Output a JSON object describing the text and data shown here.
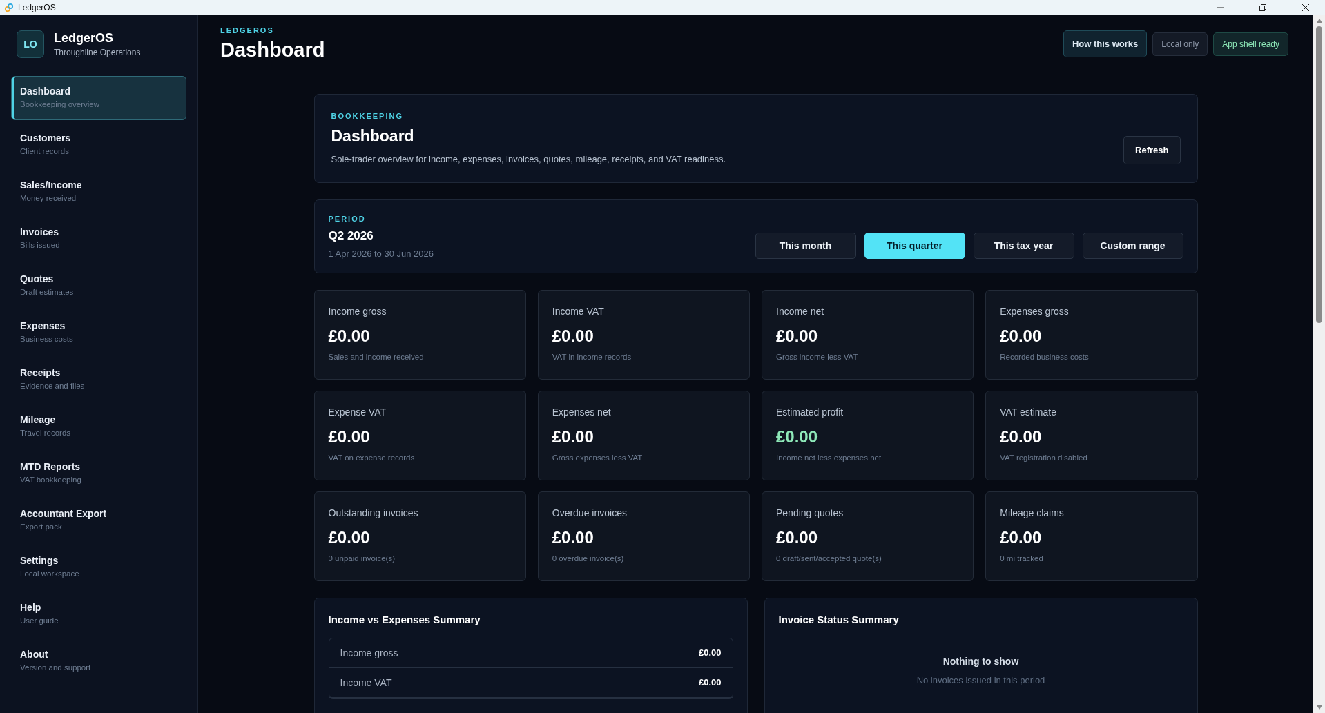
{
  "window": {
    "title": "LedgerOS"
  },
  "sidebar": {
    "logo": "LO",
    "brand": "LedgerOS",
    "subtitle": "Throughline Operations",
    "items": [
      {
        "label": "Dashboard",
        "caption": "Bookkeeping overview",
        "selected": true
      },
      {
        "label": "Customers",
        "caption": "Client records",
        "selected": false
      },
      {
        "label": "Sales/Income",
        "caption": "Money received",
        "selected": false
      },
      {
        "label": "Invoices",
        "caption": "Bills issued",
        "selected": false
      },
      {
        "label": "Quotes",
        "caption": "Draft estimates",
        "selected": false
      },
      {
        "label": "Expenses",
        "caption": "Business costs",
        "selected": false
      },
      {
        "label": "Receipts",
        "caption": "Evidence and files",
        "selected": false
      },
      {
        "label": "Mileage",
        "caption": "Travel records",
        "selected": false
      },
      {
        "label": "MTD Reports",
        "caption": "VAT bookkeeping",
        "selected": false
      },
      {
        "label": "Accountant Export",
        "caption": "Export pack",
        "selected": false
      },
      {
        "label": "Settings",
        "caption": "Local workspace",
        "selected": false
      },
      {
        "label": "Help",
        "caption": "User guide",
        "selected": false
      },
      {
        "label": "About",
        "caption": "Version and support",
        "selected": false
      }
    ]
  },
  "header": {
    "eyebrow": "LEDGEROS",
    "title": "Dashboard",
    "actions": [
      {
        "label": "How this works",
        "kind": "button"
      },
      {
        "label": "Local only",
        "kind": "muted"
      },
      {
        "label": "App shell ready",
        "kind": "success"
      }
    ]
  },
  "intro": {
    "eyebrow": "BOOKKEEPING",
    "title": "Dashboard",
    "description": "Sole-trader overview for income, expenses, invoices, quotes, mileage, receipts, and VAT readiness.",
    "button": "Refresh"
  },
  "period": {
    "eyebrow": "PERIOD",
    "title": "Q2 2026",
    "range": "1 Apr 2026 to 30 Jun 2026",
    "options": [
      {
        "label": "This month",
        "selected": false
      },
      {
        "label": "This quarter",
        "selected": true
      },
      {
        "label": "This tax year",
        "selected": false
      },
      {
        "label": "Custom range",
        "selected": false
      }
    ]
  },
  "metrics": [
    {
      "label": "Income gross",
      "value": "£0.00",
      "note": "Sales and income received",
      "highlight": false
    },
    {
      "label": "Income VAT",
      "value": "£0.00",
      "note": "VAT in income records",
      "highlight": false
    },
    {
      "label": "Income net",
      "value": "£0.00",
      "note": "Gross income less VAT",
      "highlight": false
    },
    {
      "label": "Expenses gross",
      "value": "£0.00",
      "note": "Recorded business costs",
      "highlight": false
    },
    {
      "label": "Expense VAT",
      "value": "£0.00",
      "note": "VAT on expense records",
      "highlight": false
    },
    {
      "label": "Expenses net",
      "value": "£0.00",
      "note": "Gross expenses less VAT",
      "highlight": false
    },
    {
      "label": "Estimated profit",
      "value": "£0.00",
      "note": "Income net less expenses net",
      "highlight": true
    },
    {
      "label": "VAT estimate",
      "value": "£0.00",
      "note": "VAT registration disabled",
      "highlight": false
    },
    {
      "label": "Outstanding invoices",
      "value": "£0.00",
      "note": "0 unpaid invoice(s)",
      "highlight": false
    },
    {
      "label": "Overdue invoices",
      "value": "£0.00",
      "note": "0 overdue invoice(s)",
      "highlight": false
    },
    {
      "label": "Pending quotes",
      "value": "£0.00",
      "note": "0 draft/sent/accepted quote(s)",
      "highlight": false
    },
    {
      "label": "Mileage claims",
      "value": "£0.00",
      "note": "0 mi tracked",
      "highlight": false
    }
  ],
  "summary": {
    "title": "Income vs Expenses Summary",
    "rows": [
      {
        "label": "Income gross",
        "value": "£0.00"
      },
      {
        "label": "Income VAT",
        "value": "£0.00"
      }
    ]
  },
  "invoice_status": {
    "title": "Invoice Status Summary",
    "empty_title": "Nothing to show",
    "empty_text": "No invoices issued in this period"
  }
}
